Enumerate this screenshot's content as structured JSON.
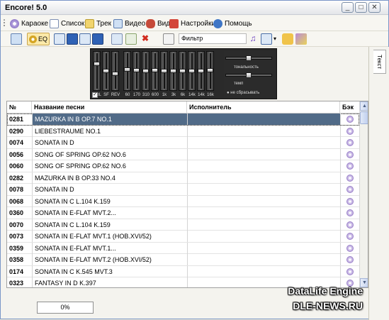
{
  "window": {
    "title": "Encore! 5.0"
  },
  "menu": [
    {
      "label": "Караоке",
      "icon": "karaoke-icon"
    },
    {
      "label": "Список",
      "icon": "list-icon"
    },
    {
      "label": "Трек",
      "icon": "track-icon"
    },
    {
      "label": "Видео",
      "icon": "video-icon"
    },
    {
      "label": "Вид",
      "icon": "view-icon"
    },
    {
      "label": "Настройки",
      "icon": "settings-icon"
    },
    {
      "label": "Помощь",
      "icon": "help-icon"
    }
  ],
  "toolbar": {
    "eq_label": "EQ",
    "filter_label": "Фильтр"
  },
  "mixer": {
    "fader_labels": [
      "VOL",
      "SF",
      "REV",
      "60",
      "170",
      "310",
      "600",
      "1k",
      "3k",
      "6k",
      "14k",
      "14k",
      "16k"
    ],
    "fader_levels": [
      0.72,
      0.5,
      0.4,
      0.55,
      0.52,
      0.5,
      0.52,
      0.5,
      0.5,
      0.5,
      0.5,
      0.5,
      0.52
    ],
    "tonality_label": "тональность",
    "tempo_label": "темп",
    "no_reset_label": "не сбрасывать"
  },
  "side_tab": {
    "label": "Текст"
  },
  "table": {
    "headers": {
      "num": "№",
      "title": "Название песни",
      "artist": "Исполнитель",
      "back": "Бэк"
    },
    "rows": [
      {
        "num": "0281",
        "title": "MAZURKA IN B OP.7 NO.1",
        "artist": "",
        "selected": true
      },
      {
        "num": "0290",
        "title": "LIEBESTRAUME NO.1",
        "artist": ""
      },
      {
        "num": "0074",
        "title": "SONATA IN D",
        "artist": ""
      },
      {
        "num": "0056",
        "title": "SONG OF SPRING OP.62 NO.6",
        "artist": ""
      },
      {
        "num": "0060",
        "title": "SONG OF SPRING OP.62 NO.6",
        "artist": ""
      },
      {
        "num": "0282",
        "title": "MAZURKA IN B OP.33 NO.4",
        "artist": ""
      },
      {
        "num": "0078",
        "title": "SONATA IN D",
        "artist": ""
      },
      {
        "num": "0068",
        "title": "SONATA IN C L.104 K.159",
        "artist": ""
      },
      {
        "num": "0360",
        "title": "SONATA IN E-FLAT MVT.2...",
        "artist": ""
      },
      {
        "num": "0070",
        "title": "SONATA IN C L.104 K.159",
        "artist": ""
      },
      {
        "num": "0073",
        "title": "SONATA IN E-FLAT  MVT.1 (HOB.XVI/52)",
        "artist": ""
      },
      {
        "num": "0359",
        "title": "SONATA IN E-FLAT MVT.1...",
        "artist": ""
      },
      {
        "num": "0358",
        "title": "SONATA IN E-FLAT MVT.2 (HOB.XVI/52)",
        "artist": ""
      },
      {
        "num": "0174",
        "title": "SONATA IN C K.545 MVT.3",
        "artist": ""
      },
      {
        "num": "0323",
        "title": "FANTASY IN D K.397",
        "artist": ""
      }
    ]
  },
  "status": {
    "progress": "0%"
  },
  "watermark": {
    "line1": "DataLife Engine",
    "line2": "DLE-NEWS.RU"
  }
}
